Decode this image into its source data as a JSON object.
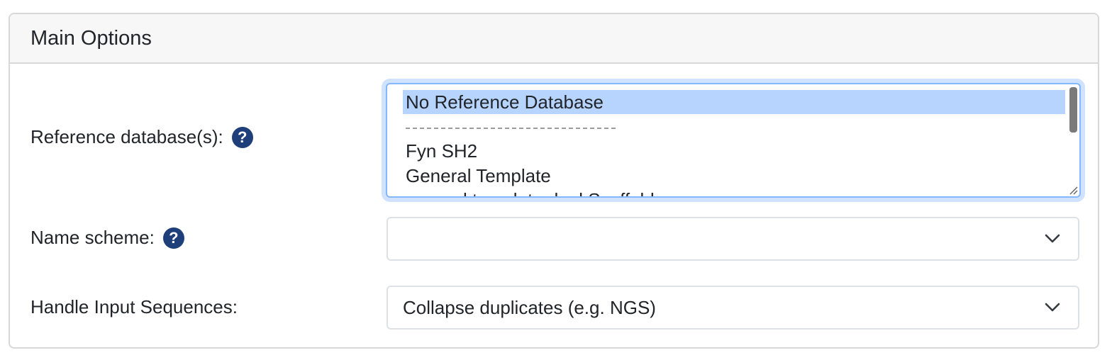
{
  "panel": {
    "title": "Main Options"
  },
  "reference": {
    "label": "Reference database(s):",
    "help_glyph": "?",
    "options": [
      {
        "label": "No Reference Database",
        "selected": true
      },
      {
        "label": "Fyn SH2",
        "selected": false
      },
      {
        "label": "General Template",
        "selected": false
      },
      {
        "label": "general template dual Scaffold",
        "selected": false
      }
    ]
  },
  "name_scheme": {
    "label": "Name scheme:",
    "help_glyph": "?",
    "value": ""
  },
  "handle_input": {
    "label": "Handle Input Sequences:",
    "value": "Collapse duplicates (e.g. NGS)"
  },
  "colors": {
    "help_icon": "#1e3f7a",
    "focus_border": "#86b7fe",
    "selected_option": "#b6d4fe"
  },
  "icons": {
    "help": "question-circle-icon",
    "dropdown": "chevron-down-icon",
    "resize": "resize-handle-icon"
  }
}
